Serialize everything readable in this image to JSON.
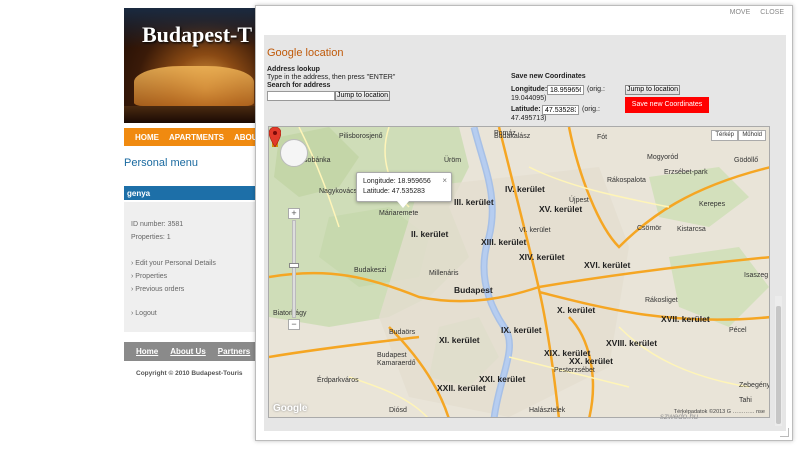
{
  "site": {
    "banner_title": "Budapest-T",
    "nav": [
      "HOME",
      "APARTMENTS",
      "ABOU"
    ],
    "personal_menu_title": "Personal menu",
    "username": "genya",
    "id_number": "ID number: 3581",
    "properties_count": "Properties: 1",
    "menu_items": [
      "Edit your Personal Details",
      "Properties",
      "Previous orders"
    ],
    "logout": "Logout",
    "footer_links": [
      "Home",
      "About Us",
      "Partners"
    ],
    "copyright": "Copyright © 2010 Budapest-Touris"
  },
  "dialog": {
    "move": "MOVE",
    "close": "CLOSE",
    "title": "Google location",
    "address_lookup_label": "Address lookup",
    "address_hint": "Type in the address, then press \"ENTER\"",
    "search_label": "Search for address",
    "search_value": "",
    "jump_button_left": "Jump to location",
    "save_coords_heading": "Save new Coordinates",
    "longitude_label": "Longitude:",
    "longitude_value": "18.959656",
    "longitude_orig": "(orig.:",
    "longitude_orig_value": "19.044095)",
    "latitude_label": "Latitude:",
    "latitude_value": "47.535283",
    "latitude_orig": "(orig.:",
    "latitude_orig_value": "47.495713)",
    "jump_button_right": "Jump to location",
    "save_button": "Save new Coordinates"
  },
  "map": {
    "type_map": "Térkép",
    "type_satellite": "Műhold",
    "info_longitude": "Longitude: 18.959656",
    "info_latitude": "Latitude: 47.535283",
    "info_close": "×",
    "attribution": "Térképadatok ©2013 G",
    "attribution_end": "nse",
    "google_logo": "Google",
    "labels": [
      "Pilisborosjenő",
      "Üröm",
      "Budakalász",
      "Csobánka",
      "Pomáz",
      "Fót",
      "Nagykovácsi",
      "Máriaremete",
      "II. kerület",
      "III. kerület",
      "Budapest",
      "IV. kerület",
      "XV. kerület",
      "Mogyoród",
      "Gödöllő",
      "Budakeszi",
      "XIII. kerület",
      "XIV. kerület",
      "XVI. kerület",
      "Kistarcsa",
      "Kerepes",
      "Csömör",
      "Isaszeg",
      "Pécel",
      "Rákosliget",
      "XVII. kerület",
      "X. kerület",
      "XI. kerület",
      "IX. kerület",
      "XIX. kerület",
      "XVIII. kerület",
      "XX. kerület",
      "Pesterzsébet",
      "Budaörs",
      "Budapest Kamaraerdő",
      "Érdparkváros",
      "XXII. kerület",
      "XXI. kerület",
      "Biatorbágy",
      "Millenáris",
      "Újpest",
      "Rákospalota",
      "VI. kerület",
      "Halásztelek",
      "Diósd",
      "Tahi",
      "Zebegény",
      "Erzsébet-park"
    ]
  },
  "watermark": "szwedo.hu"
}
